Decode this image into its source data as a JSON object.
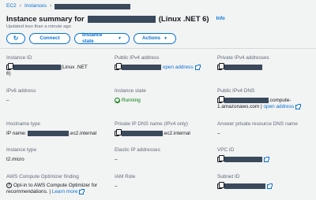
{
  "breadcrumb": {
    "root": "EC2",
    "instances": "Instances"
  },
  "header": {
    "title": "Instance summary for",
    "title_suffix": "(Linux .NET 6)",
    "info": "Info",
    "updated": "Updated less than a minute ago"
  },
  "toolbar": {
    "connect": "Connect",
    "instance_state": "Instance state",
    "actions": "Actions"
  },
  "details": {
    "instance_id": {
      "label": "Instance ID",
      "value_suffix": "(Linux .NET",
      "value_line2": "6)"
    },
    "public_ipv4": {
      "label": "Public IPv4 address",
      "link": "open address"
    },
    "private_ipv4": {
      "label": "Private IPv4 addresses"
    },
    "ipv6": {
      "label": "IPv6 address",
      "value": "–"
    },
    "instance_state": {
      "label": "Instance state",
      "value": "Running"
    },
    "public_dns": {
      "label": "Public IPv4 DNS",
      "value_suffix": ".compute-",
      "value_line2": "1.amazonaws.com",
      "separator": " | ",
      "link": "open address"
    },
    "hostname_type": {
      "label": "Hostname type",
      "prefix": "IP name:",
      "suffix": ".ec2.internal"
    },
    "private_dns": {
      "label": "Private IP DNS name (IPv4 only)",
      "suffix": ".ec2.internal"
    },
    "answer_dns": {
      "label": "Answer private resource DNS name",
      "value": "–"
    },
    "instance_type": {
      "label": "Instance type",
      "value": "t2.micro"
    },
    "elastic_ip": {
      "label": "Elastic IP addresses",
      "value": "–"
    },
    "vpc_id": {
      "label": "VPC ID"
    },
    "optimizer": {
      "label": "AWS Compute Optimizer finding",
      "text": "Opt-in to AWS Compute Optimizer for recommendations.",
      "separator": " | ",
      "link": "Learn more"
    },
    "iam_role": {
      "label": "IAM Role",
      "value": "–"
    },
    "subnet_id": {
      "label": "Subnet ID"
    }
  }
}
